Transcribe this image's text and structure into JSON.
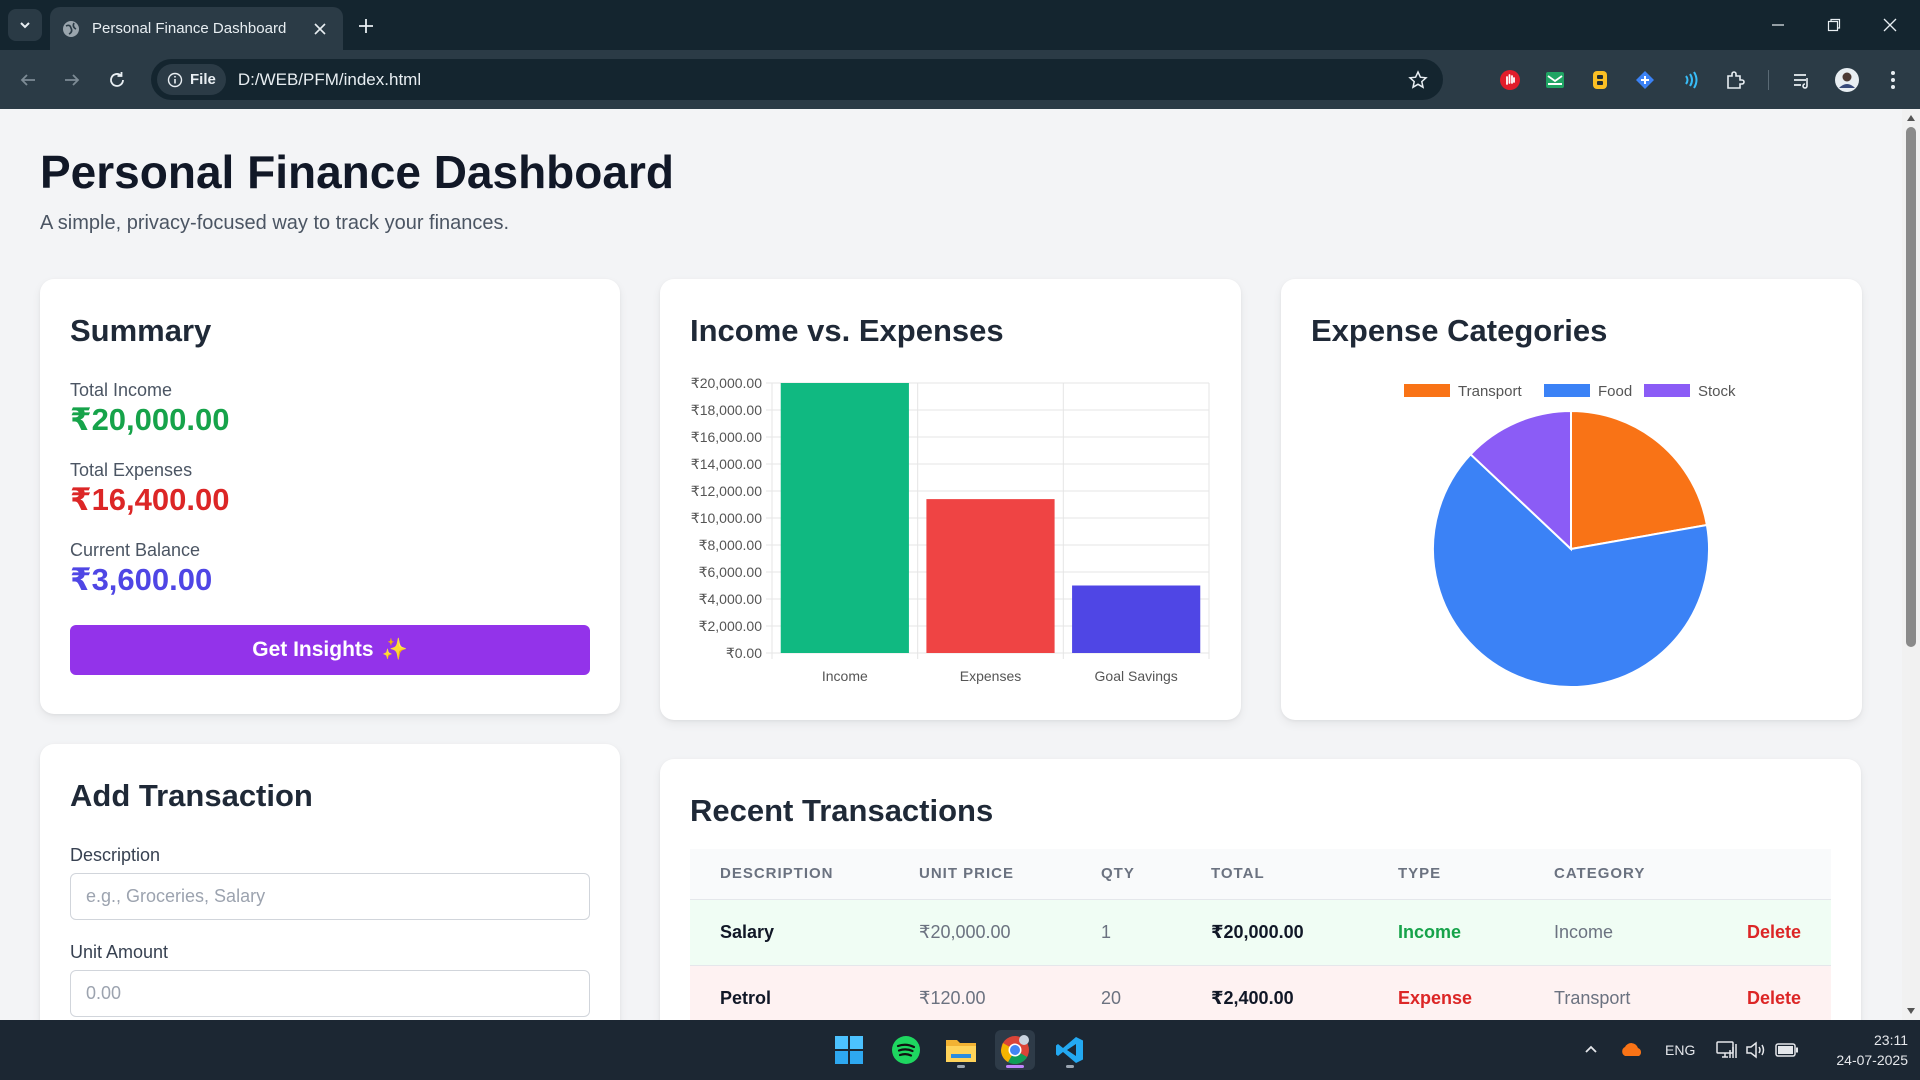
{
  "browser": {
    "tab_title": "Personal Finance Dashboard",
    "site_chip": "File",
    "url": "D:/WEB/PFM/index.html"
  },
  "page": {
    "title": "Personal Finance Dashboard",
    "subtitle": "A simple, privacy-focused way to track your finances."
  },
  "summary": {
    "title": "Summary",
    "income_label": "Total Income",
    "income_value": "₹20,000.00",
    "expenses_label": "Total Expenses",
    "expenses_value": "₹16,400.00",
    "balance_label": "Current Balance",
    "balance_value": "₹3,600.00",
    "insights_label": "Get Insights",
    "insights_icon": "✨"
  },
  "charts": {
    "bar_title": "Income vs. Expenses",
    "pie_title": "Expense Categories"
  },
  "chart_data": [
    {
      "type": "bar",
      "categories": [
        "Income",
        "Expenses",
        "Goal Savings"
      ],
      "values": [
        20000,
        11400,
        5000
      ],
      "colors": [
        "#10b981",
        "#ef4444",
        "#4f46e5"
      ],
      "ylim": [
        0,
        20000
      ],
      "yticks": [
        "₹0.00",
        "₹2,000.00",
        "₹4,000.00",
        "₹6,000.00",
        "₹8,000.00",
        "₹10,000.00",
        "₹12,000.00",
        "₹14,000.00",
        "₹16,000.00",
        "₹18,000.00",
        "₹20,000.00"
      ],
      "grid": true
    },
    {
      "type": "pie",
      "labels": [
        "Transport",
        "Food",
        "Stock"
      ],
      "values": [
        2400,
        7000,
        1400
      ],
      "colors": [
        "#f97316",
        "#3b82f6",
        "#8b5cf6"
      ],
      "legend": "top"
    }
  ],
  "form": {
    "title": "Add Transaction",
    "description_label": "Description",
    "description_placeholder": "e.g., Groceries, Salary",
    "amount_label": "Unit Amount",
    "amount_placeholder": "0.00"
  },
  "transactions": {
    "title": "Recent Transactions",
    "headers": [
      "DESCRIPTION",
      "UNIT PRICE",
      "QTY",
      "TOTAL",
      "TYPE",
      "CATEGORY"
    ],
    "rows": [
      {
        "description": "Salary",
        "unit_price": "₹20,000.00",
        "qty": "1",
        "total": "₹20,000.00",
        "type": "Income",
        "category": "Income",
        "action": "Delete"
      },
      {
        "description": "Petrol",
        "unit_price": "₹120.00",
        "qty": "20",
        "total": "₹2,400.00",
        "type": "Expense",
        "category": "Transport",
        "action": "Delete"
      }
    ]
  },
  "taskbar": {
    "language": "ENG",
    "time": "23:11",
    "date": "24-07-2025"
  },
  "colors": {
    "income": "#16a34a",
    "expense": "#dc2626",
    "balance": "#4f46e5",
    "button": "#9333ea"
  }
}
